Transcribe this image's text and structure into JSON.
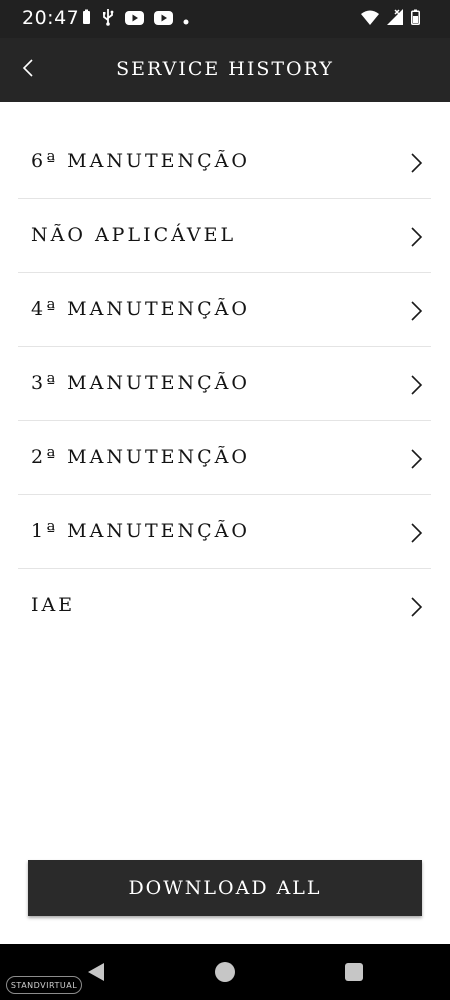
{
  "status_bar": {
    "time": "20:47",
    "icons": [
      "battery-alert-icon",
      "usb-icon",
      "youtube-icon",
      "youtube-icon",
      "dot-icon",
      "wifi-icon",
      "signal-icon",
      "battery-icon"
    ]
  },
  "header": {
    "title": "SERVICE HISTORY",
    "back_icon": "chevron-left-icon"
  },
  "service_list": {
    "items": [
      {
        "label": "6ª MANUTENÇÃO"
      },
      {
        "label": "NÃO APLICÁVEL"
      },
      {
        "label": "4ª MANUTENÇÃO"
      },
      {
        "label": "3ª MANUTENÇÃO"
      },
      {
        "label": "2ª MANUTENÇÃO"
      },
      {
        "label": "1ª MANUTENÇÃO"
      },
      {
        "label": "IAE"
      }
    ]
  },
  "download_button": {
    "label": "DOWNLOAD ALL"
  },
  "watermark": {
    "text": "STANDVIRTUAL"
  },
  "colors": {
    "header_bg": "#262626",
    "status_bg": "#212121",
    "button_bg": "#2a2a2a",
    "divider": "#e4e4e4",
    "text": "#141414"
  }
}
